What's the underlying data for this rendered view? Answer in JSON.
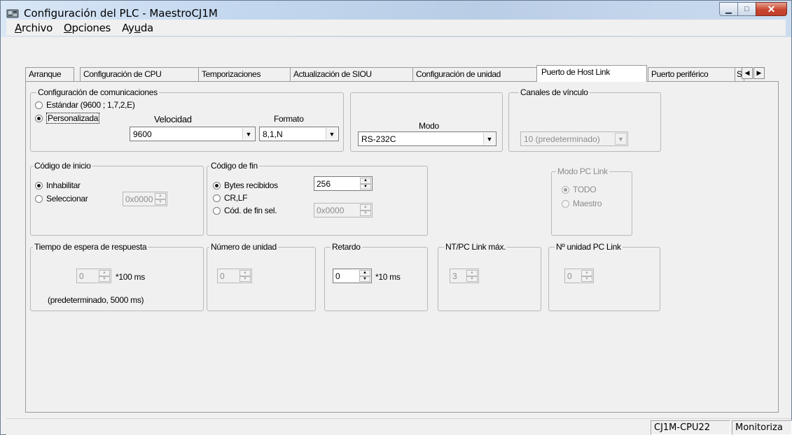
{
  "window": {
    "title": "Configuración del PLC - MaestroCJ1M"
  },
  "menu": {
    "archivo_hot": "A",
    "archivo_rest": "rchivo",
    "opciones_hot": "O",
    "opciones_rest": "pciones",
    "ayuda_pre": "Ay",
    "ayuda_hot": "u",
    "ayuda_rest": "da"
  },
  "tabs": [
    {
      "label": "Arranque"
    },
    {
      "label": "Configuración de CPU"
    },
    {
      "label": "Temporizaciones"
    },
    {
      "label": "Actualización de SIOU"
    },
    {
      "label": "Configuración de unidad"
    },
    {
      "label": "Puerto de Host Link"
    },
    {
      "label": "Puerto periférico"
    },
    {
      "label": "S"
    }
  ],
  "comms": {
    "legend": "Configuración de comunicaciones",
    "standard_label": "Estándar (9600 ; 1,7,2,E)",
    "custom_label": "Personalizada",
    "speed_label": "Velocidad",
    "speed_value": "9600",
    "format_label": "Formato",
    "format_value": "8,1,N"
  },
  "mode": {
    "label": "Modo",
    "value": "RS-232C"
  },
  "channels": {
    "legend": "Canales de vínculo",
    "value": "10 (predeterminado)"
  },
  "start_code": {
    "legend": "Código de inicio",
    "disable_label": "Inhabilitar",
    "select_label": "Seleccionar",
    "value": "0x0000"
  },
  "end_code": {
    "legend": "Código de fin",
    "bytes_label": "Bytes recibidos",
    "bytes_value": "256",
    "crlf_label": "CR,LF",
    "sel_label": "Cód. de fin sel.",
    "sel_value": "0x0000"
  },
  "pc_link_mode": {
    "legend": "Modo PC Link",
    "all_label": "TODO",
    "master_label": "Maestro"
  },
  "response_timeout": {
    "legend": "Tiempo de espera de respuesta",
    "value": "0",
    "unit": "*100 ms",
    "note": "(predeterminado, 5000 ms)"
  },
  "unit_number": {
    "legend": "Número de unidad",
    "value": "0"
  },
  "delay": {
    "legend": "Retardo",
    "value": "0",
    "unit": "*10 ms"
  },
  "nt_pc_link_max": {
    "legend": "NT/PC Link máx.",
    "value": "3"
  },
  "pc_link_unit": {
    "legend": "Nº unidad PC Link",
    "value": "0"
  },
  "status": {
    "model": "CJ1M-CPU22",
    "mode": "Monitoriza"
  }
}
